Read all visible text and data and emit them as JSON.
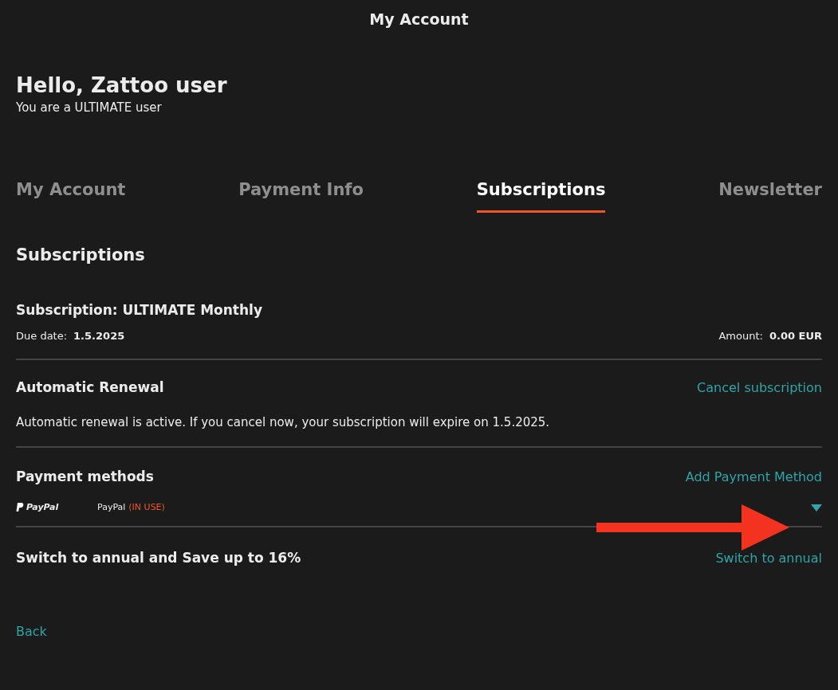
{
  "header": {
    "title": "My Account"
  },
  "greeting": {
    "title": "Hello, Zattoo user",
    "subtitle": "You are a ULTIMATE user"
  },
  "tabs": [
    {
      "label": "My Account",
      "selected": false
    },
    {
      "label": "Payment Info",
      "selected": false
    },
    {
      "label": "Subscriptions",
      "selected": true
    },
    {
      "label": "Newsletter",
      "selected": false
    }
  ],
  "section_title": "Subscriptions",
  "subscription": {
    "title": "Subscription: ULTIMATE Monthly",
    "due_label": "Due date:",
    "due_value": "1.5.2025",
    "amount_label": "Amount:",
    "amount_value": "0.00 EUR"
  },
  "renewal": {
    "title": "Automatic Renewal",
    "link": "Cancel subscription",
    "text": "Automatic renewal is active. If you cancel now, your subscription will expire on 1.5.2025."
  },
  "payment_methods": {
    "title": "Payment methods",
    "link": "Add Payment Method",
    "methods": [
      {
        "logo": "PayPal",
        "name": "PayPal",
        "status": "(IN USE)",
        "expanded": false
      }
    ]
  },
  "annual": {
    "title": "Switch to annual and Save up to 16%",
    "link": "Switch to annual"
  },
  "back": "Back"
}
